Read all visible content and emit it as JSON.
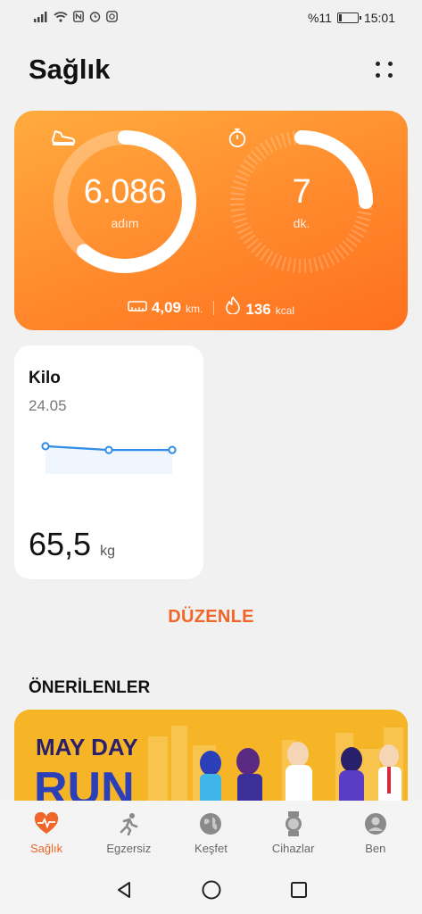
{
  "status_bar": {
    "battery_percent": "%11",
    "time": "15:01",
    "icons": [
      "signal-icon",
      "wifi-icon",
      "nfc-icon",
      "alarm-icon",
      "instagram-icon"
    ]
  },
  "header": {
    "title": "Sağlık",
    "more_icon": "more-dots-icon"
  },
  "activity": {
    "steps": {
      "value": "6.086",
      "unit": "adım",
      "progress": 0.61,
      "icon": "shoe-icon"
    },
    "active_time": {
      "value": "7",
      "unit": "dk.",
      "progress": 0.25,
      "icon": "stopwatch-icon"
    },
    "distance": {
      "value": "4,09",
      "unit": "km.",
      "icon": "ruler-icon"
    },
    "calories": {
      "value": "136",
      "unit": "kcal",
      "icon": "flame-icon"
    },
    "colors": {
      "card_start": "#ffab3e",
      "card_end": "#ff6f1e"
    }
  },
  "weight": {
    "title": "Kilo",
    "date": "24.05",
    "value": "65,5",
    "unit": "kg",
    "trend": [
      65.6,
      65.5,
      65.5
    ],
    "line_color": "#2f8ce8"
  },
  "edit_label": "DÜZENLE",
  "recommended": {
    "title": "ÖNERİLENLER",
    "banner_text": "MAY DAY",
    "banner_text_2": "RUN"
  },
  "bottom_nav": [
    {
      "label": "Sağlık",
      "icon": "heart-pulse-icon",
      "active": true
    },
    {
      "label": "Egzersiz",
      "icon": "running-icon",
      "active": false
    },
    {
      "label": "Keşfet",
      "icon": "globe-icon",
      "active": false
    },
    {
      "label": "Cihazlar",
      "icon": "watch-icon",
      "active": false
    },
    {
      "label": "Ben",
      "icon": "profile-icon",
      "active": false
    }
  ],
  "accent_color": "#f0662a"
}
